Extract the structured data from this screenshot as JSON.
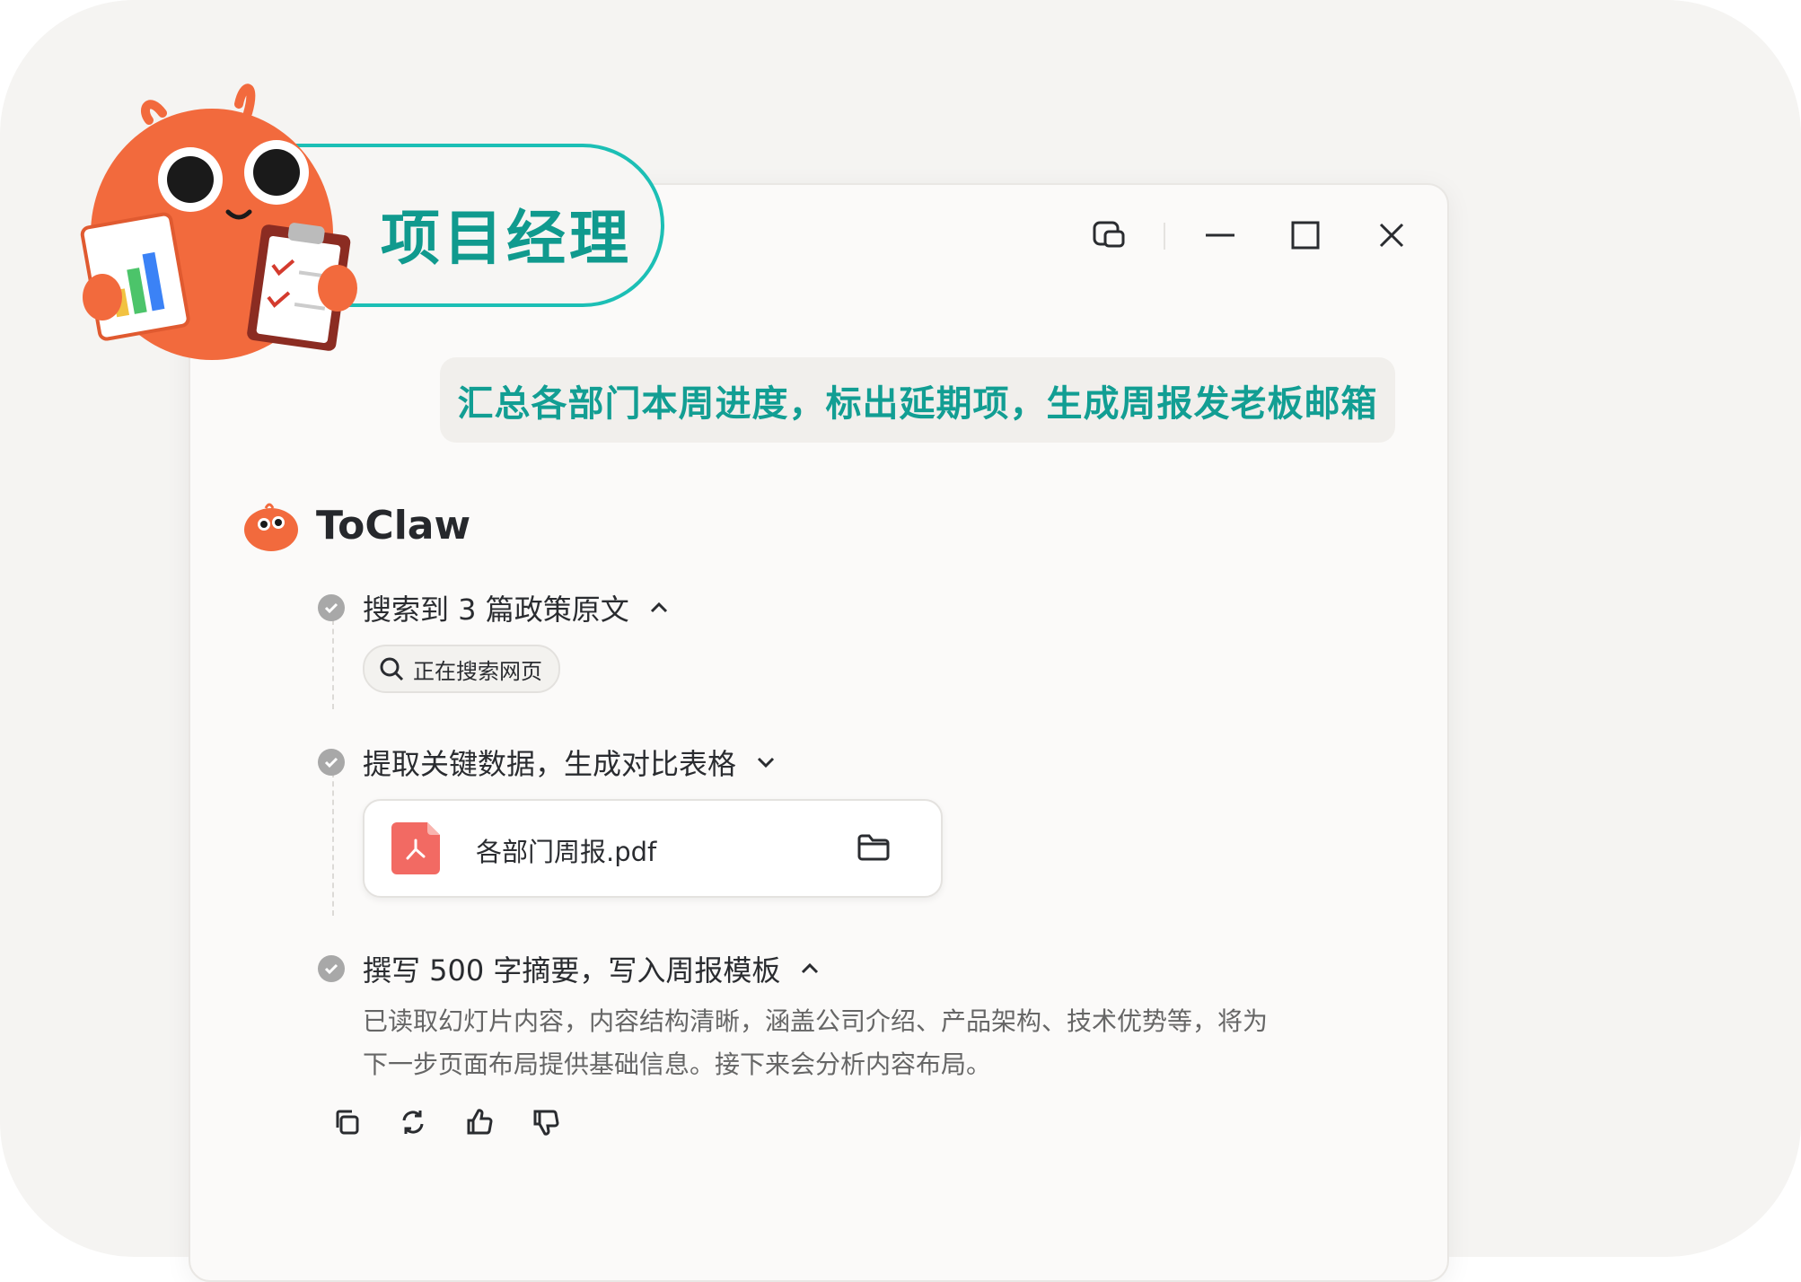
{
  "role": {
    "title": "项目经理"
  },
  "prompt": {
    "text": "汇总各部门本周进度，标出延期项，生成周报发老板邮箱"
  },
  "assistant": {
    "name": "ToClaw"
  },
  "steps": [
    {
      "label": "搜索到 3 篇政策原文",
      "chevron": "up",
      "chip": "正在搜索网页"
    },
    {
      "label": "提取关键数据，生成对比表格",
      "chevron": "down",
      "file": "各部门周报.pdf"
    },
    {
      "label": "撰写 500 字摘要，写入周报模板",
      "chevron": "up"
    }
  ],
  "summary": {
    "line1": "已读取幻灯片内容，内容结构清晰，涵盖公司介绍、产品架构、技术优势等，将为",
    "line2": "下一步页面布局提供基础信息。接下来会分析内容布局。"
  },
  "colors": {
    "accent": "#1cbfb5",
    "accent_text": "#129e93",
    "mascot": "#f26a3d",
    "pdf": "#f26a63"
  },
  "icons": [
    "pip-icon",
    "minimize-icon",
    "maximize-icon",
    "close-icon",
    "search-icon",
    "pdf-icon",
    "folder-icon",
    "copy-icon",
    "refresh-icon",
    "thumbs-up-icon",
    "thumbs-down-icon"
  ]
}
